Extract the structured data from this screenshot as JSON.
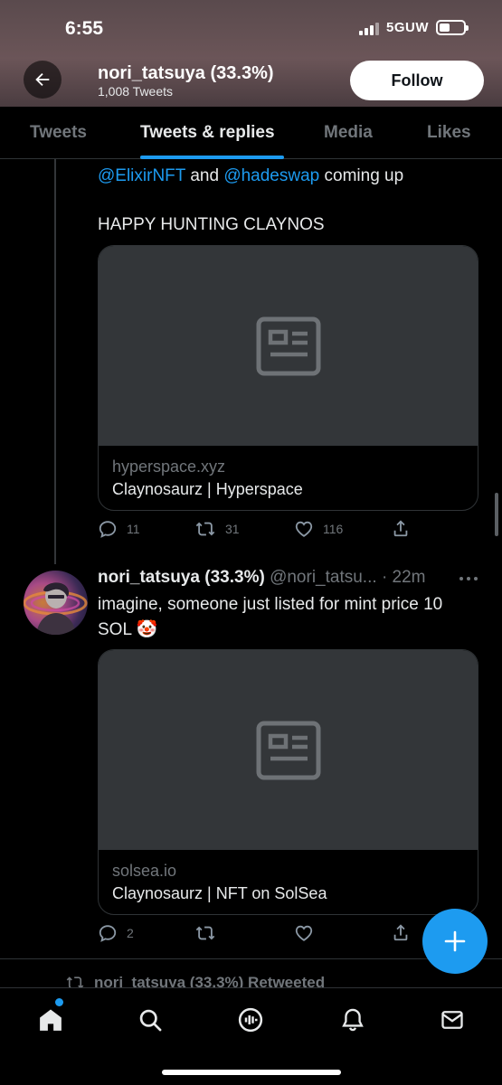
{
  "status_bar": {
    "time": "6:55",
    "network": "5GUW"
  },
  "profile": {
    "name": "nori_tatsuya (33.3%)",
    "tweet_count": "1,008 Tweets",
    "follow_label": "Follow"
  },
  "tabs": [
    {
      "label": "Tweets"
    },
    {
      "label": "Tweets & replies"
    },
    {
      "label": "Media"
    },
    {
      "label": "Likes"
    }
  ],
  "active_tab": "Tweets & replies",
  "tweet1": {
    "mention1": "@ElixirNFT",
    "and": " and ",
    "mention2": "@hadeswap",
    "text_suffix": " coming up",
    "text2": "HAPPY HUNTING CLAYNOS",
    "card": {
      "domain": "hyperspace.xyz",
      "title": "Claynosaurz | Hyperspace"
    },
    "replies": "11",
    "retweets": "31",
    "likes": "116"
  },
  "tweet2": {
    "name": "nori_tatsuya (33.3%)",
    "handle": "@nori_tatsu...",
    "time": "· 22m",
    "text_line1": "imagine, someone just listed for mint price 10",
    "text_line2": "SOL 🤡",
    "card": {
      "domain": "solsea.io",
      "title": "Claynosaurz | NFT on SolSea"
    },
    "replies": "2"
  },
  "retweeted_label": "nori_tatsuya (33.3%) Retweeted",
  "colors": {
    "accent": "#1d9bf0",
    "background": "#000000",
    "muted": "#71767b"
  }
}
